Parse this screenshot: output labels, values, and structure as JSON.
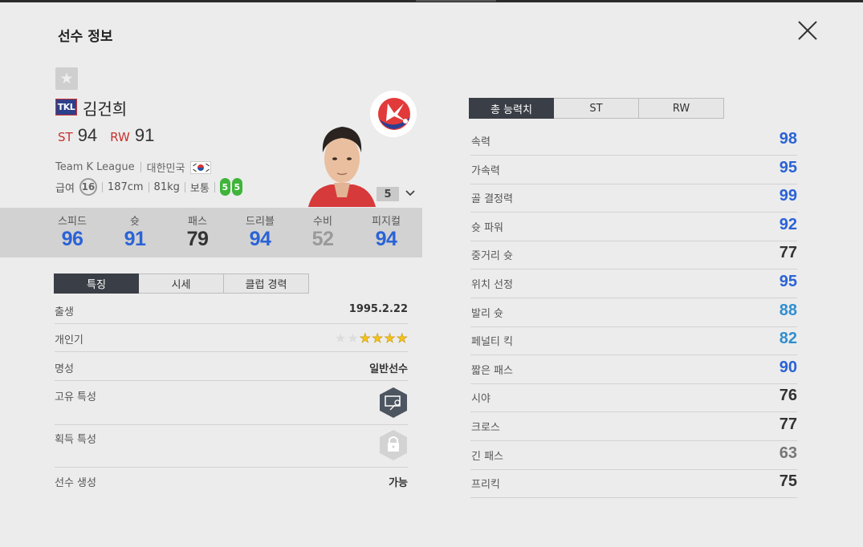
{
  "header": {
    "title": "선수 정보"
  },
  "player": {
    "season_badge": "TKL",
    "name": "김건희",
    "positions": [
      {
        "pos": "ST",
        "ovr": "94"
      },
      {
        "pos": "RW",
        "ovr": "91"
      }
    ],
    "team": "Team K League",
    "nation": "대한민국",
    "salary_label": "급여",
    "salary": "16",
    "height": "187cm",
    "weight": "81kg",
    "body": "보통",
    "foot_left": "5",
    "foot_right": "5",
    "level": "5"
  },
  "summary_stats": [
    {
      "label": "스피드",
      "value": "96",
      "color": "#2a63d6"
    },
    {
      "label": "슛",
      "value": "91",
      "color": "#2a63d6"
    },
    {
      "label": "패스",
      "value": "79",
      "color": "#333333"
    },
    {
      "label": "드리블",
      "value": "94",
      "color": "#2a63d6"
    },
    {
      "label": "수비",
      "value": "52",
      "color": "#9a9a9a"
    },
    {
      "label": "피지컬",
      "value": "94",
      "color": "#2a63d6"
    }
  ],
  "left_tabs": [
    "특징",
    "시세",
    "클럽 경력"
  ],
  "details": {
    "birth_label": "출생",
    "birth": "1995.2.22",
    "popularity_label": "개인기",
    "popularity_stars": 4,
    "popularity_max": 6,
    "fame_label": "명성",
    "fame": "일반선수",
    "unique_trait_label": "고유 특성",
    "acquired_trait_label": "획득 특성",
    "create_label": "선수 생성",
    "create": "가능"
  },
  "right_tabs": [
    "총 능력치",
    "ST",
    "RW"
  ],
  "attributes": [
    {
      "label": "속력",
      "value": "98",
      "color": "#2a63d6"
    },
    {
      "label": "가속력",
      "value": "95",
      "color": "#2a63d6"
    },
    {
      "label": "골 결정력",
      "value": "99",
      "color": "#2a63d6"
    },
    {
      "label": "슛 파워",
      "value": "92",
      "color": "#2a63d6"
    },
    {
      "label": "중거리 슛",
      "value": "77",
      "color": "#333333"
    },
    {
      "label": "위치 선정",
      "value": "95",
      "color": "#2a63d6"
    },
    {
      "label": "발리 슛",
      "value": "88",
      "color": "#2f8fd0"
    },
    {
      "label": "페널티 킥",
      "value": "82",
      "color": "#2f8fd0"
    },
    {
      "label": "짧은 패스",
      "value": "90",
      "color": "#2a63d6"
    },
    {
      "label": "시야",
      "value": "76",
      "color": "#333333"
    },
    {
      "label": "크로스",
      "value": "77",
      "color": "#333333"
    },
    {
      "label": "긴 패스",
      "value": "63",
      "color": "#777777"
    },
    {
      "label": "프리킥",
      "value": "75",
      "color": "#333333"
    }
  ]
}
